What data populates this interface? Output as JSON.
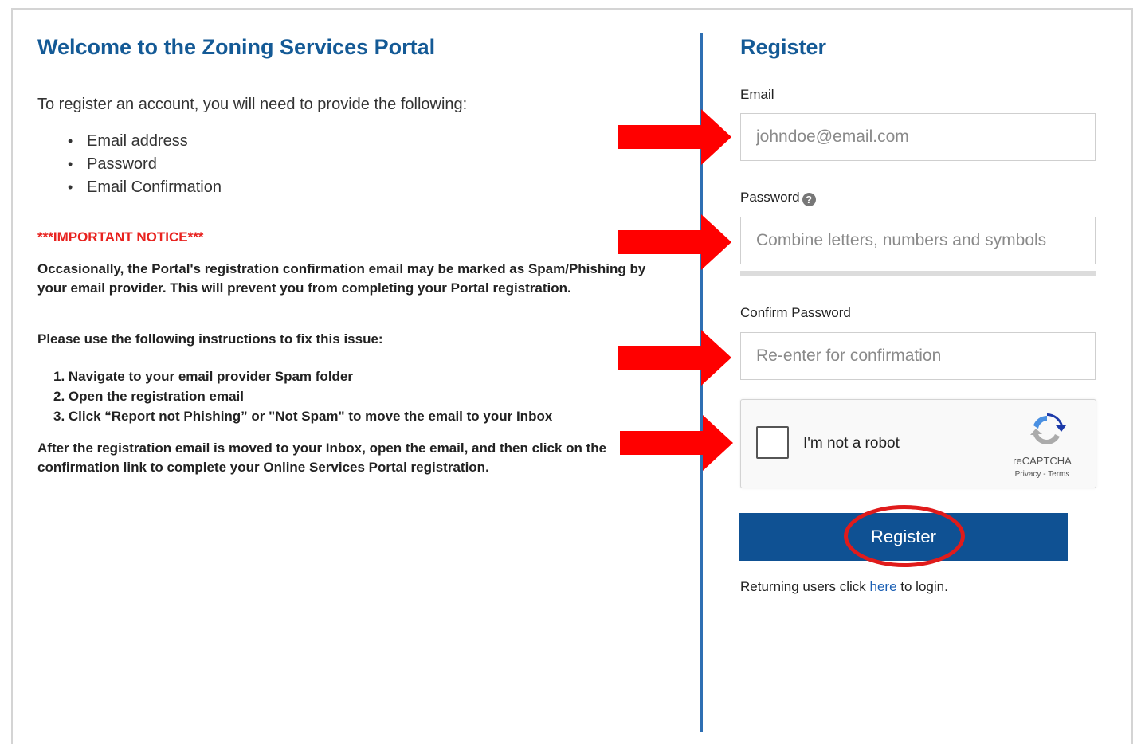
{
  "left": {
    "title": "Welcome to the Zoning Services Portal",
    "intro": "To register an account, you will need to provide the following:",
    "requirements": [
      "Email address",
      "Password",
      "Email Confirmation"
    ],
    "notice_title": "***IMPORTANT NOTICE***",
    "notice_text": "Occasionally, the Portal's registration confirmation email may be marked as Spam/Phishing by your email provider. This will prevent you from completing your Portal registration.",
    "instructions_intro": "Please use the following instructions to fix this issue:",
    "steps": [
      "1. Navigate to your email provider Spam folder",
      "2. Open the registration email",
      "3. Click “Report not Phishing” or \"Not Spam\" to move the email to your Inbox"
    ],
    "closing_text": "After the registration email is moved to your Inbox, open the email, and then click on the confirmation link to complete your Online Services Portal registration."
  },
  "register": {
    "title": "Register",
    "email_label": "Email",
    "email_placeholder": "johndoe@email.com",
    "password_label": "Password",
    "password_help_icon": "question-circle-icon",
    "password_placeholder": "Combine letters, numbers and symbols",
    "confirm_label": "Confirm Password",
    "confirm_placeholder": "Re-enter for confirmation",
    "captcha_text": "I'm not a robot",
    "captcha_brand": "reCAPTCHA",
    "captcha_links": "Privacy - Terms",
    "button_label": "Register",
    "returning_prefix": "Returning users click ",
    "returning_link": "here",
    "returning_suffix": " to login."
  },
  "colors": {
    "title_blue": "#145a96",
    "button_blue": "#0f5193",
    "notice_red": "#e8221f",
    "annotation_red": "#ff0000",
    "divider_blue": "#2e6fb3"
  }
}
